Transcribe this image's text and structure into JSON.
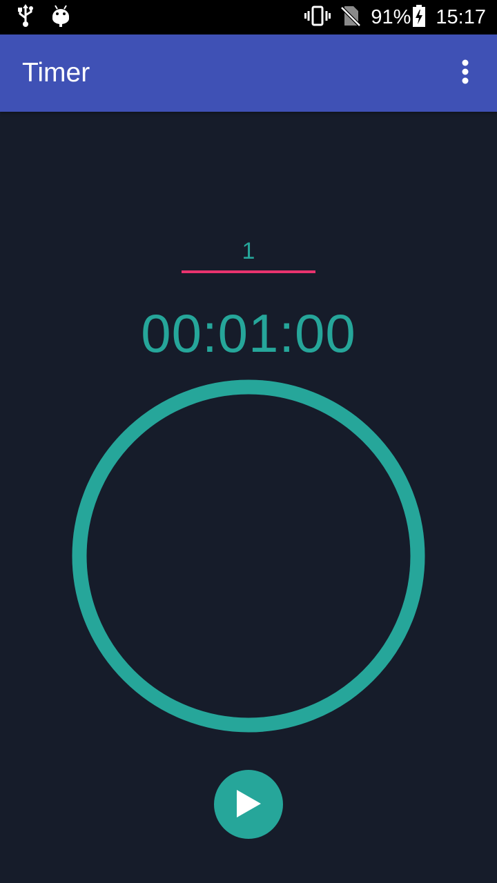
{
  "status_bar": {
    "battery_percent": "91%",
    "time": "15:17",
    "icons": [
      "usb-icon",
      "android-debug-icon",
      "vibrate-icon",
      "no-sim-icon",
      "battery-charging-icon"
    ]
  },
  "app_bar": {
    "title": "Timer",
    "menu_icon": "overflow-menu-icon"
  },
  "timer": {
    "minutes_value": "1",
    "display": "00:01:00",
    "progress": 1.0,
    "play_icon": "play-icon"
  },
  "colors": {
    "accent": "#26a69a",
    "primary": "#3f51b5",
    "input_underline": "#e8336e",
    "background": "#161c2a"
  }
}
